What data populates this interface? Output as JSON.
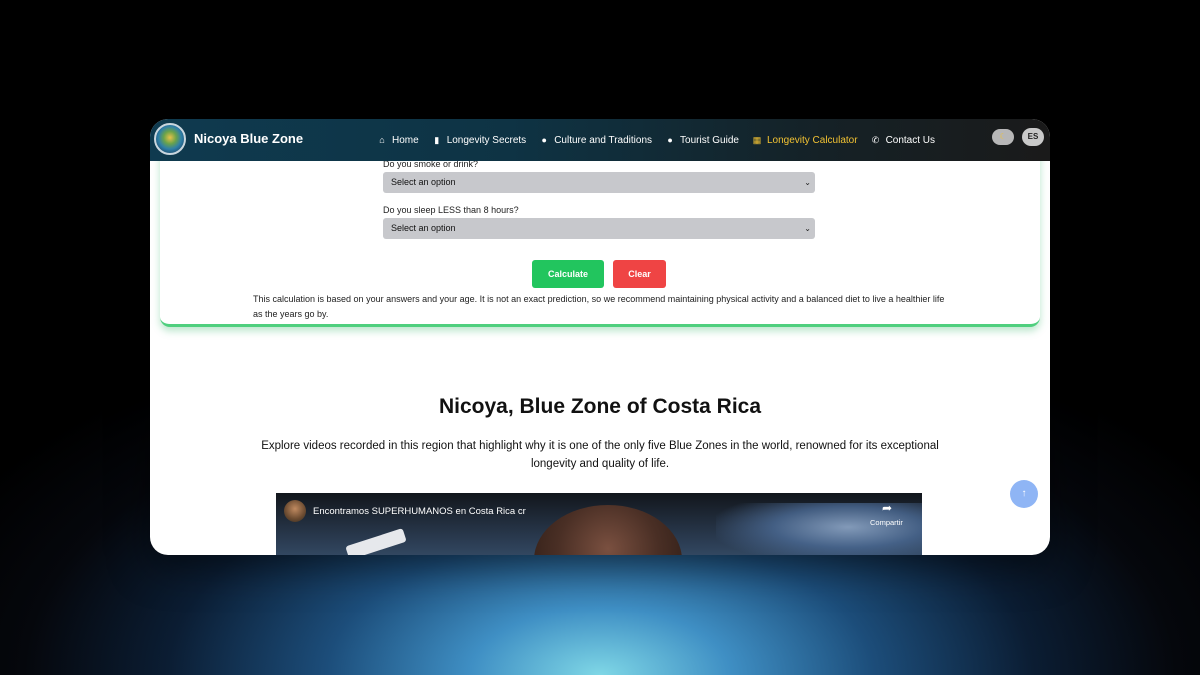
{
  "app": {
    "brand": "Nicoya Blue Zone",
    "lang_button": "ES",
    "theme_toggle_icon": "moon-icon"
  },
  "nav": {
    "items": [
      {
        "label": "Home",
        "icon": "home-icon",
        "glyph": "⌂"
      },
      {
        "label": "Longevity Secrets",
        "icon": "book-icon",
        "glyph": "▮"
      },
      {
        "label": "Culture and Traditions",
        "icon": "map-pin-icon",
        "glyph": "●"
      },
      {
        "label": "Tourist Guide",
        "icon": "map-pin-icon",
        "glyph": "●"
      },
      {
        "label": "Longevity Calculator",
        "icon": "calculator-icon",
        "glyph": "▦",
        "active": true
      },
      {
        "label": "Contact Us",
        "icon": "phone-icon",
        "glyph": "✆"
      }
    ],
    "active_color": "#f2c233"
  },
  "calculator": {
    "q_smoke": "Do you smoke or drink?",
    "q_smoke_value": "Select an option",
    "q_sleep": "Do you sleep LESS than 8 hours?",
    "q_sleep_value": "Select an option",
    "calculate_label": "Calculate",
    "clear_label": "Clear",
    "disclaimer": "This calculation is based on your answers and your age. It is not an exact prediction, so we recommend maintaining physical activity and a balanced diet to live a healthier life as the years go by."
  },
  "section": {
    "title": "Nicoya, Blue Zone of Costa Rica",
    "description": "Explore videos recorded in this region that highlight why it is one of the only five Blue Zones in the world, renowned for its exceptional longevity and quality of life."
  },
  "video": {
    "title": "Encontramos SUPERHUMANOS en Costa Rica cr",
    "share_label": "Compartir"
  },
  "scroll_top": {
    "glyph": "↑"
  },
  "colors": {
    "calculate": "#22c55e",
    "clear": "#ef4444",
    "accent_green": "#4fcf7e"
  }
}
